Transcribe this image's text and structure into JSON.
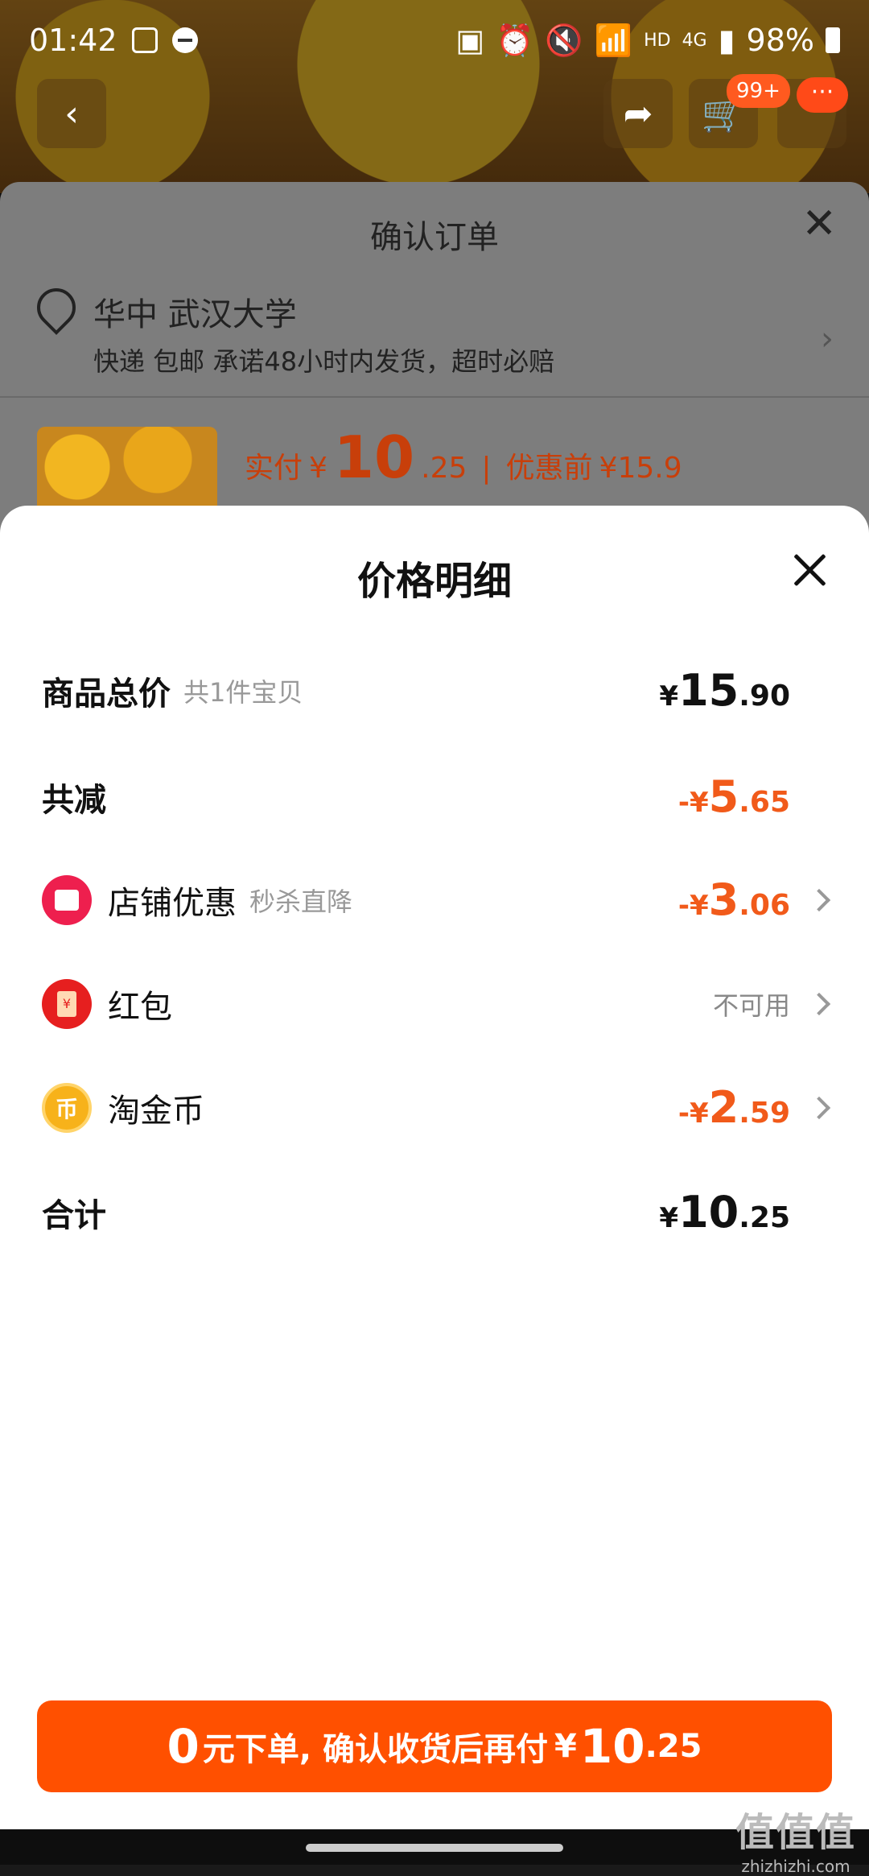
{
  "status_bar": {
    "time": "01:42",
    "network": "4G",
    "hd": "HD",
    "battery": "98%"
  },
  "top_nav": {
    "cart_badge": "99+",
    "more_badge": "···"
  },
  "order": {
    "title": "确认订单",
    "address": "华中 武汉大学",
    "shipping_note": "快递 包邮 承诺48小时内发货，超时必赔",
    "paid_label": "实付",
    "paid_currency": "¥",
    "paid_int": "10",
    "paid_dec": ".25",
    "before_label": "优惠前",
    "before_price": "¥15.9"
  },
  "price_detail": {
    "title": "价格明细",
    "rows": {
      "total": {
        "label": "商品总价",
        "sub": "共1件宝贝",
        "currency": "¥",
        "int": "15",
        "dec": ".90"
      },
      "reduce": {
        "label": "共减",
        "currency": "-¥",
        "int": "5",
        "dec": ".65"
      },
      "store": {
        "label": "店铺优惠",
        "sub": "秒杀直降",
        "currency": "-¥",
        "int": "3",
        "dec": ".06"
      },
      "redpack": {
        "label": "红包",
        "status": "不可用",
        "icon_char": "¥"
      },
      "coin": {
        "label": "淘金币",
        "currency": "-¥",
        "int": "2",
        "dec": ".59",
        "icon_char": "币"
      },
      "sum": {
        "label": "合计",
        "currency": "¥",
        "int": "10",
        "dec": ".25"
      }
    }
  },
  "cta": {
    "zero": "0",
    "text": "元下单, 确认收货后再付",
    "currency": "¥",
    "int": "10",
    "dec": ".25"
  },
  "watermark": {
    "logo": "值值值",
    "url": "zhizhizhi.com"
  },
  "colors": {
    "accent": "#ff5000",
    "discount": "#f15a1a",
    "store_icon": "#ee1f4e",
    "redpack_icon": "#e61f1f",
    "coin_icon": "#f7b21a"
  }
}
